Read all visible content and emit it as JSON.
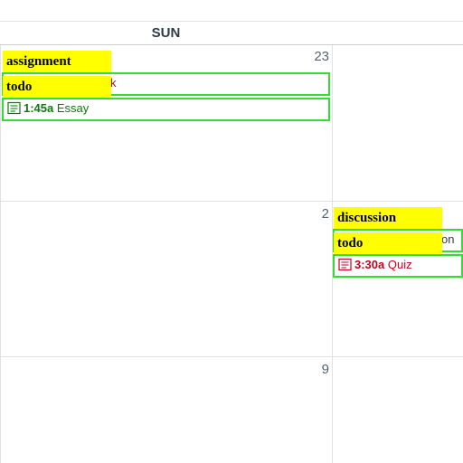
{
  "header": {
    "day_label": "SUN"
  },
  "week1": {
    "sun_date": "23",
    "events": [
      {
        "partial_text": "k"
      },
      {
        "time": "1:45a",
        "title": "Essay"
      }
    ],
    "tags": {
      "assignment": "assignment",
      "todo": "todo"
    }
  },
  "week2": {
    "sun_date": "2",
    "mon_events": [
      {
        "partial_text": "on"
      },
      {
        "time": "3:30a",
        "title": "Quiz"
      }
    ],
    "tags": {
      "discussion": "discussion",
      "todo": "todo"
    }
  },
  "week3": {
    "sun_date": "9"
  },
  "colors": {
    "event_border": "#33dd33",
    "tag_bg": "#ffff00",
    "red_text": "#c7001f",
    "green_text": "#0b7a0b"
  }
}
